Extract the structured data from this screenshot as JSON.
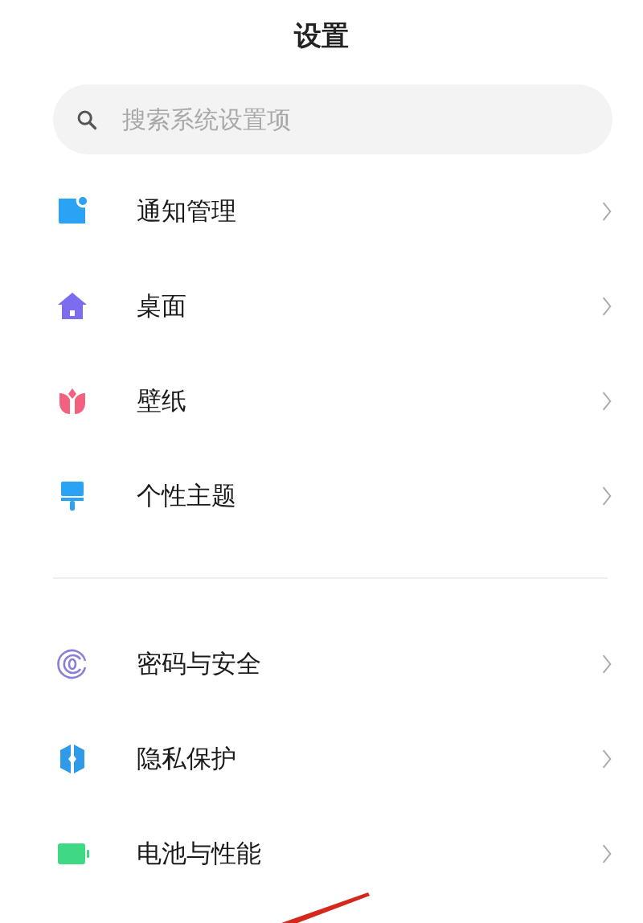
{
  "title": "设置",
  "search": {
    "placeholder": "搜索系统设置项"
  },
  "sections": [
    {
      "items": [
        {
          "kind": "notification",
          "label": "通知管理"
        },
        {
          "kind": "home",
          "label": "桌面"
        },
        {
          "kind": "flower",
          "label": "壁纸"
        },
        {
          "kind": "brush",
          "label": "个性主题"
        }
      ]
    },
    {
      "items": [
        {
          "kind": "fingerprint",
          "label": "密码与安全"
        },
        {
          "kind": "shield",
          "label": "隐私保护"
        },
        {
          "kind": "battery",
          "label": "电池与性能"
        }
      ]
    }
  ]
}
